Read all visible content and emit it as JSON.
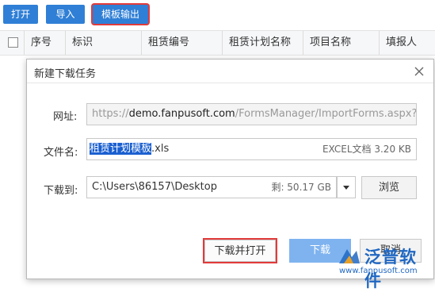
{
  "toolbar": {
    "open_label": "打开",
    "import_label": "导入",
    "template_export_label": "模板输出"
  },
  "grid": {
    "columns": [
      "序号",
      "标识",
      "租赁编号",
      "租赁计划名称",
      "项目名称",
      "填报人"
    ]
  },
  "dialog": {
    "title": "新建下载任务",
    "url_label": "网址:",
    "url_prefix": "https://",
    "url_domain": "demo.fanpusoft.com",
    "url_path": "/FormsManager/ImportForms.aspx?Formi",
    "filename_label": "文件名:",
    "filename_selected": "租赁计划模板",
    "filename_ext": ".xls",
    "file_info": "EXCEL文档 3.20 KB",
    "download_to_label": "下载到:",
    "download_path": "C:\\Users\\86157\\Desktop",
    "free_space": "剩: 50.17 GB",
    "browse_label": "浏览",
    "download_open_label": "下载并打开",
    "download_label": "下载",
    "cancel_label": "取消"
  },
  "watermark": {
    "brand": "泛普软件",
    "url": "www.fanpusoft.com"
  },
  "colors": {
    "toolbar_blue": "#2f7fd6",
    "highlight_red": "#e23b3b",
    "primary_light": "#7fb3ef",
    "brand_blue": "#1f67c2"
  }
}
